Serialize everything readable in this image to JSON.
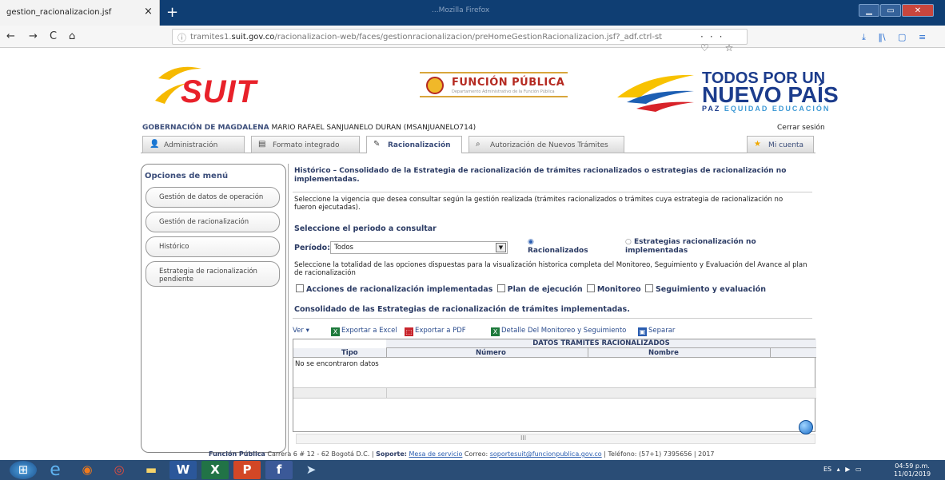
{
  "browser": {
    "tab_title": "gestion_racionalizacion.jsf",
    "tab_close": "×",
    "new_tab": "+",
    "window_title": "...Mozilla Firefox",
    "url_prefix": "tramites1.",
    "url_domain": "suit.gov.co",
    "url_rest": "/racionalizacion-web/faces/gestionracionalizacion/preHomeGestionRacionalizacion.jsf?_adf.ctrl-st",
    "nav_back": "←",
    "nav_forward": "→",
    "nav_reload": "C",
    "nav_home": "⌂",
    "url_actions": "··· ♡ ☆",
    "toolbar_right": "⤓ ‖\\ ▢ ≡"
  },
  "header": {
    "suit_logo": "SUIT",
    "funcion_publica": "FUNCIÓN PÚBLICA",
    "funcion_publica_sub": "Departamento Administrativo de la Función Pública",
    "todos": "TODOS POR UN",
    "nuevo_pais": "NUEVO PAÍS",
    "paz": "PAZ",
    "equidad": "EQUIDAD",
    "educacion": "EDUCACIÓN",
    "entity": "GOBERNACIÓN DE MAGDALENA",
    "user": "MARIO RAFAEL SANJUANELO DURAN (MSANJUANELO714)",
    "logout": "Cerrar sesión"
  },
  "tabs": [
    {
      "label": "Administración",
      "icon": "👤"
    },
    {
      "label": "Formato integrado",
      "icon": "▤"
    },
    {
      "label": "Racionalización",
      "icon": "✎"
    },
    {
      "label": "Autorización de Nuevos Trámites",
      "icon": "⌕"
    },
    {
      "label": "Mi cuenta",
      "icon": "★"
    }
  ],
  "menu": {
    "title": "Opciones de menú",
    "items": [
      "Gestión de datos de operación",
      "Gestión de racionalización",
      "Histórico",
      "Estrategia de racionalización pendiente"
    ]
  },
  "main": {
    "title": "Histórico – Consolidado de la Estrategia de racionalización de trámites racionalizados o estrategias de racionalización no implementadas.",
    "intro": "Seleccione la vigencia que desea consultar según la gestión realizada (trámites racionalizados o trámites cuya estrategia de racionalización no fueron ejecutadas).",
    "period_heading": "Seleccione el periodo a consultar",
    "period_label": "Período:",
    "period_value": "Todos",
    "radio1": "Racionalizados",
    "radio2": "Estrategias racionalización no implementadas",
    "select_text": "Seleccione la totalidad de las opciones dispuestas para la visualización historica completa del Monitoreo, Seguimiento y Evaluación del Avance al plan de racionalización",
    "checks": [
      "Acciones de racionalización implementadas",
      "Plan de ejecución",
      "Monitoreo",
      "Seguimiento y evaluación"
    ],
    "consolidated": "Consolidado de las Estrategias de racionalización de trámites implementadas."
  },
  "grid": {
    "toolbar": {
      "view": "Ver ▾",
      "excel": "Exportar a Excel",
      "pdf": "Exportar a PDF",
      "detail": "Detalle Del Monitoreo y Seguimiento",
      "detach": "Separar"
    },
    "group_header": "DATOS TRAMITES RACIONALIZADOS",
    "columns": [
      "Tipo",
      "Número",
      "Nombre"
    ],
    "empty": "No se encontraron datos",
    "scroll_mark": "III"
  },
  "footer": {
    "org": "Función Pública",
    "address": "Carrera 6 # 12 - 62 Bogotá D.C. |",
    "support_label": "Soporte:",
    "support_link": "Mesa de servicio",
    "mail_label": "Correo:",
    "mail": "soportesuit@funcionpublica.gov.co",
    "phone": "| Teléfono: (57+1) 7395656 | 2017"
  },
  "taskbar": {
    "lang": "ES",
    "time": "04:59 p.m.",
    "date": "11/01/2019",
    "apps": [
      "⊞",
      "e",
      "◉",
      "◎",
      "▬",
      "W",
      "X",
      "P",
      "f",
      "➤"
    ]
  }
}
